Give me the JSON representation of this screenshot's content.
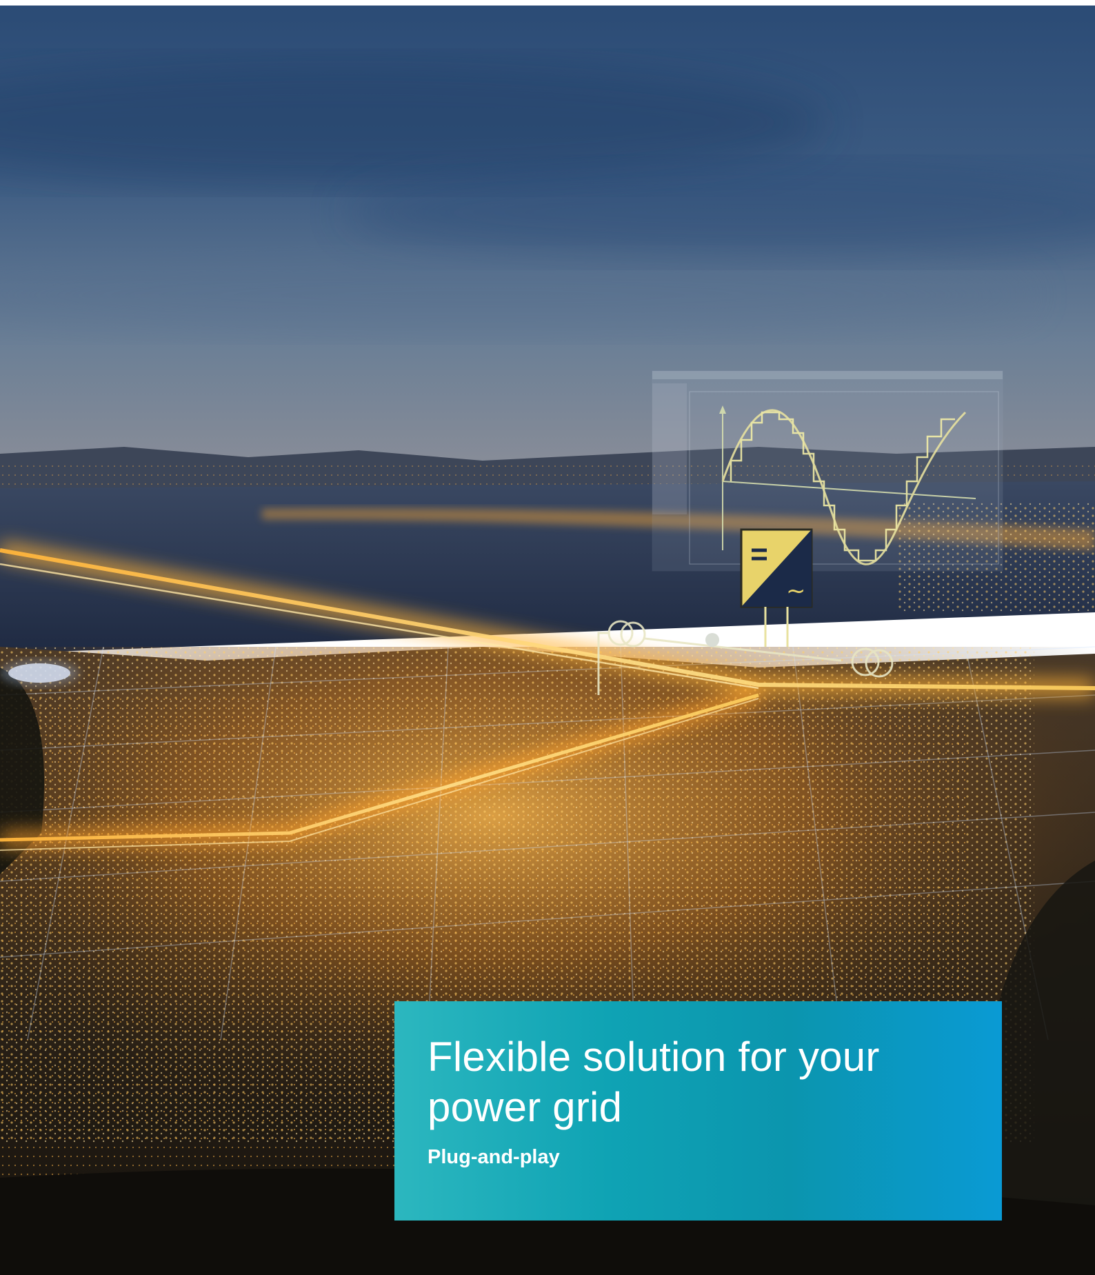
{
  "banner": {
    "title": "Flexible solution for your power grid",
    "subtitle": "Plug-and-play",
    "colors": {
      "start": "#2cb7bf",
      "end": "#0a9ad4",
      "text": "#ffffff"
    }
  },
  "photo": {
    "scene": "city-at-night-with-power-grid-overlay",
    "colors": {
      "sky_top": "#2b4e78",
      "sky_horizon": "#6c7c90",
      "water": "#24304c",
      "city_glow": "#f0a437",
      "grid_light": "#ffd46a"
    }
  }
}
